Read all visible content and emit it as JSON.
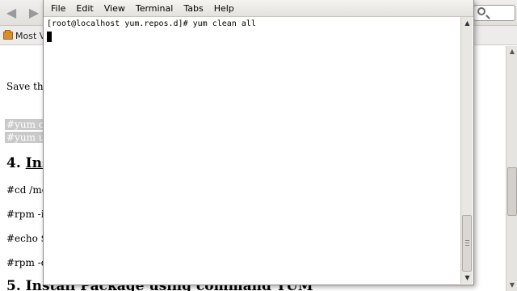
{
  "browser": {
    "nav": {
      "back_icon": "back-arrow-icon",
      "forward_icon": "forward-arrow-icon",
      "search_icon": "search-icon"
    },
    "bookmarks": {
      "most_visited_label": "Most V"
    },
    "document": {
      "save_text": "Save the",
      "highlight_line_1": "#yum cl",
      "highlight_line_2": "#yum up",
      "heading_4_number": "4.",
      "heading_4_text": "Ins",
      "cmd_cd": "#cd /me",
      "cmd_rpm_i": "#rpm -i",
      "cmd_echo": "#echo $",
      "cmd_rpm_q": "#rpm -q",
      "heading_5": "5. Install Package using command YUM"
    }
  },
  "terminal": {
    "menu": [
      "File",
      "Edit",
      "View",
      "Terminal",
      "Tabs",
      "Help"
    ],
    "prompt_line": "[root@localhost yum.repos.d]# yum clean all"
  },
  "colors": {
    "highlight_bg": "#c9c9c9",
    "menubar": "#e9e7e4",
    "cursor": "#000000"
  }
}
